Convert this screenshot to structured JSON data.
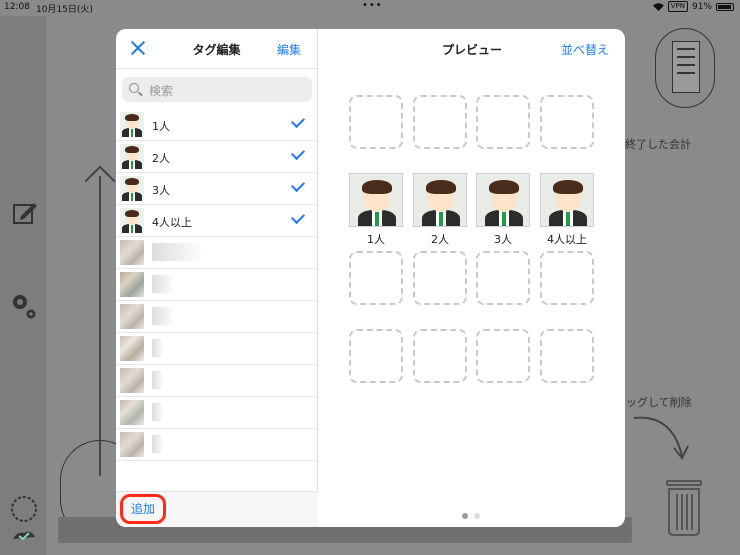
{
  "status_bar": {
    "time": "12:08",
    "date": "10月15日(火)",
    "dots": "•••",
    "vpn": "VPN",
    "battery": "91%"
  },
  "background": {
    "completed_text": "終了した会計",
    "drag_text": "ッグして削除"
  },
  "tag_editor": {
    "title": "タグ編集",
    "edit_label": "編集",
    "search_placeholder": "検索",
    "tags": [
      {
        "label": "1人",
        "checked": true
      },
      {
        "label": "2人",
        "checked": true
      },
      {
        "label": "3人",
        "checked": true
      },
      {
        "label": "4人以上",
        "checked": true
      }
    ],
    "add_label": "追加"
  },
  "preview": {
    "title": "プレビュー",
    "sort_label": "並べ替え",
    "tiles": [
      "1人",
      "2人",
      "3人",
      "4人以上"
    ],
    "page_count": 2,
    "current_page": 1
  },
  "colors": {
    "accent": "#1e7cf2",
    "highlight": "#ff2a1a",
    "tie": "#1f9d44"
  }
}
